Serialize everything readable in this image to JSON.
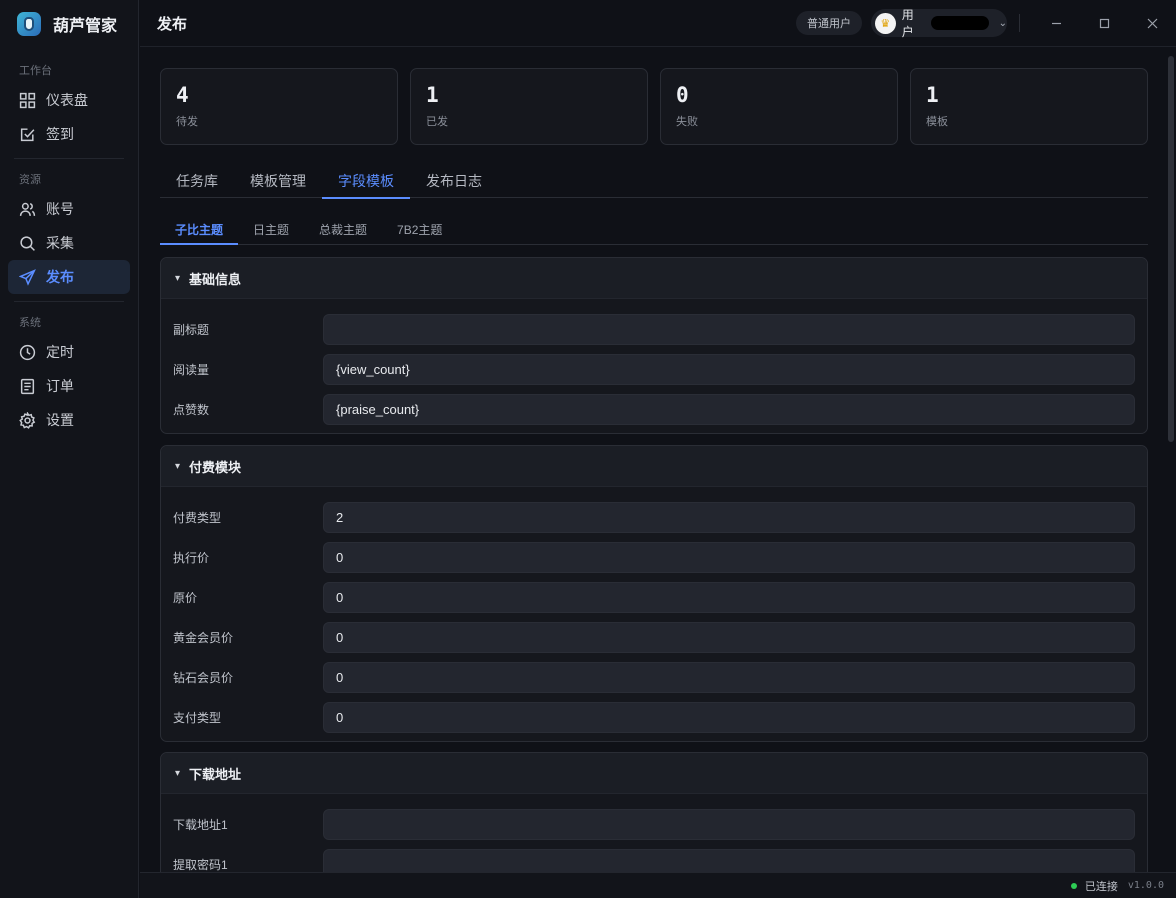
{
  "app": {
    "name": "葫芦管家"
  },
  "sidebar": {
    "sections": [
      {
        "label": "工作台",
        "items": [
          {
            "label": "仪表盘",
            "icon": "dashboard-icon"
          },
          {
            "label": "签到",
            "icon": "checkin-icon"
          }
        ]
      },
      {
        "label": "资源",
        "items": [
          {
            "label": "账号",
            "icon": "users-icon"
          },
          {
            "label": "采集",
            "icon": "search-icon"
          },
          {
            "label": "发布",
            "icon": "send-icon",
            "active": true
          }
        ]
      },
      {
        "label": "系统",
        "items": [
          {
            "label": "定时",
            "icon": "clock-icon"
          },
          {
            "label": "订单",
            "icon": "order-icon"
          },
          {
            "label": "设置",
            "icon": "gear-icon"
          }
        ]
      }
    ]
  },
  "header": {
    "title": "发布",
    "role": "普通用户",
    "user_label": "用户"
  },
  "stats": [
    {
      "value": "4",
      "label": "待发"
    },
    {
      "value": "1",
      "label": "已发"
    },
    {
      "value": "0",
      "label": "失败"
    },
    {
      "value": "1",
      "label": "模板"
    }
  ],
  "tabs": [
    "任务库",
    "模板管理",
    "字段模板",
    "发布日志"
  ],
  "active_tab": "字段模板",
  "subtabs": [
    "子比主题",
    "日主题",
    "总裁主题",
    "7B2主题"
  ],
  "active_subtab": "子比主题",
  "sections": {
    "basic": {
      "title": "基础信息",
      "fields": [
        {
          "label": "副标题",
          "value": ""
        },
        {
          "label": "阅读量",
          "value": "{view_count}"
        },
        {
          "label": "点赞数",
          "value": "{praise_count}"
        }
      ]
    },
    "pay": {
      "title": "付费模块",
      "fields": [
        {
          "label": "付费类型",
          "value": "2"
        },
        {
          "label": "执行价",
          "value": "0"
        },
        {
          "label": "原价",
          "value": "0"
        },
        {
          "label": "黄金会员价",
          "value": "0"
        },
        {
          "label": "钻石会员价",
          "value": "0"
        },
        {
          "label": "支付类型",
          "value": "0"
        }
      ]
    },
    "download": {
      "title": "下载地址",
      "fields": [
        {
          "label": "下载地址1",
          "value": ""
        },
        {
          "label": "提取密码1",
          "value": ""
        }
      ]
    }
  },
  "status": {
    "text": "已连接",
    "version": "v1.0.0",
    "color": "#2ecc55"
  },
  "colors": {
    "accent": "#5b8dff",
    "background": "#0f1117"
  }
}
